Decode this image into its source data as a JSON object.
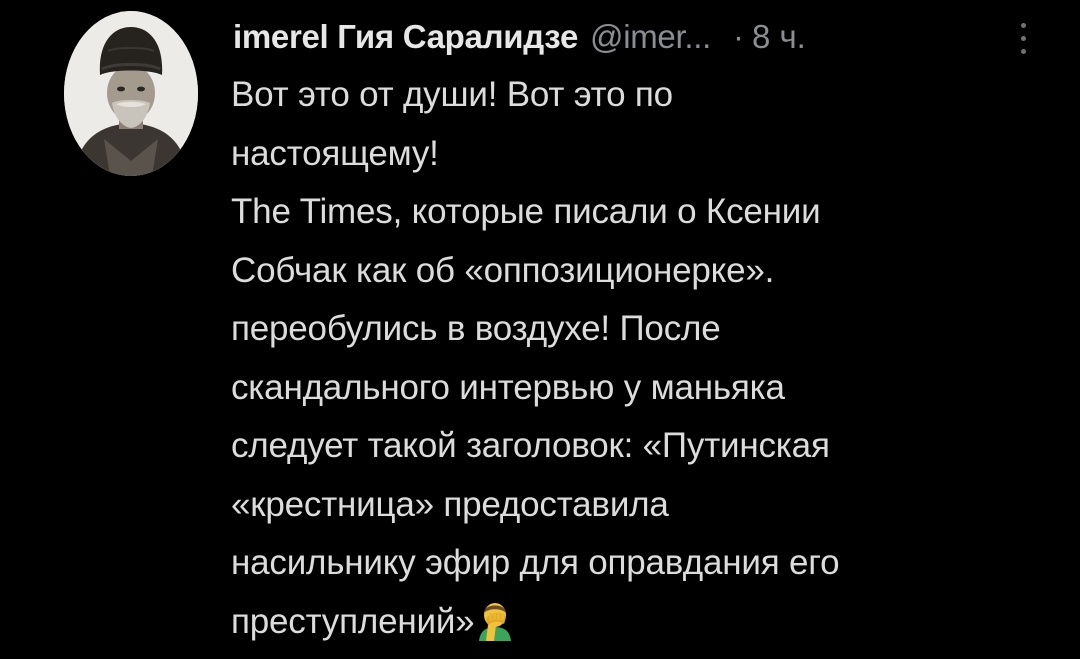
{
  "tweet": {
    "author": {
      "display_name": "imerel Гия Саралидзе",
      "handle": "@imer...",
      "avatar_icon": "portrait-avatar"
    },
    "separator": "·",
    "timestamp": "8 ч.",
    "more_icon": "vertical-ellipsis-icon",
    "text_lines": [
      "Вот это от души! Вот это по",
      "настоящему!",
      "The Times, которые писали о Ксении",
      "Собчак как об «оппозиционерке».",
      "переобулись в воздухе! После",
      "скандального интервью у маньяка",
      "следует такой заголовок: «Путинская",
      "«крестница» предоставила",
      "насильнику эфир для оправдания его",
      "преступлений»"
    ],
    "trailing_emoji": "facepalm-emoji"
  },
  "colors": {
    "background": "#000000",
    "text": "#dcdcdc",
    "muted": "#8a8d91",
    "emoji_skin": "#f2c23a",
    "emoji_shirt": "#3aa55a"
  }
}
